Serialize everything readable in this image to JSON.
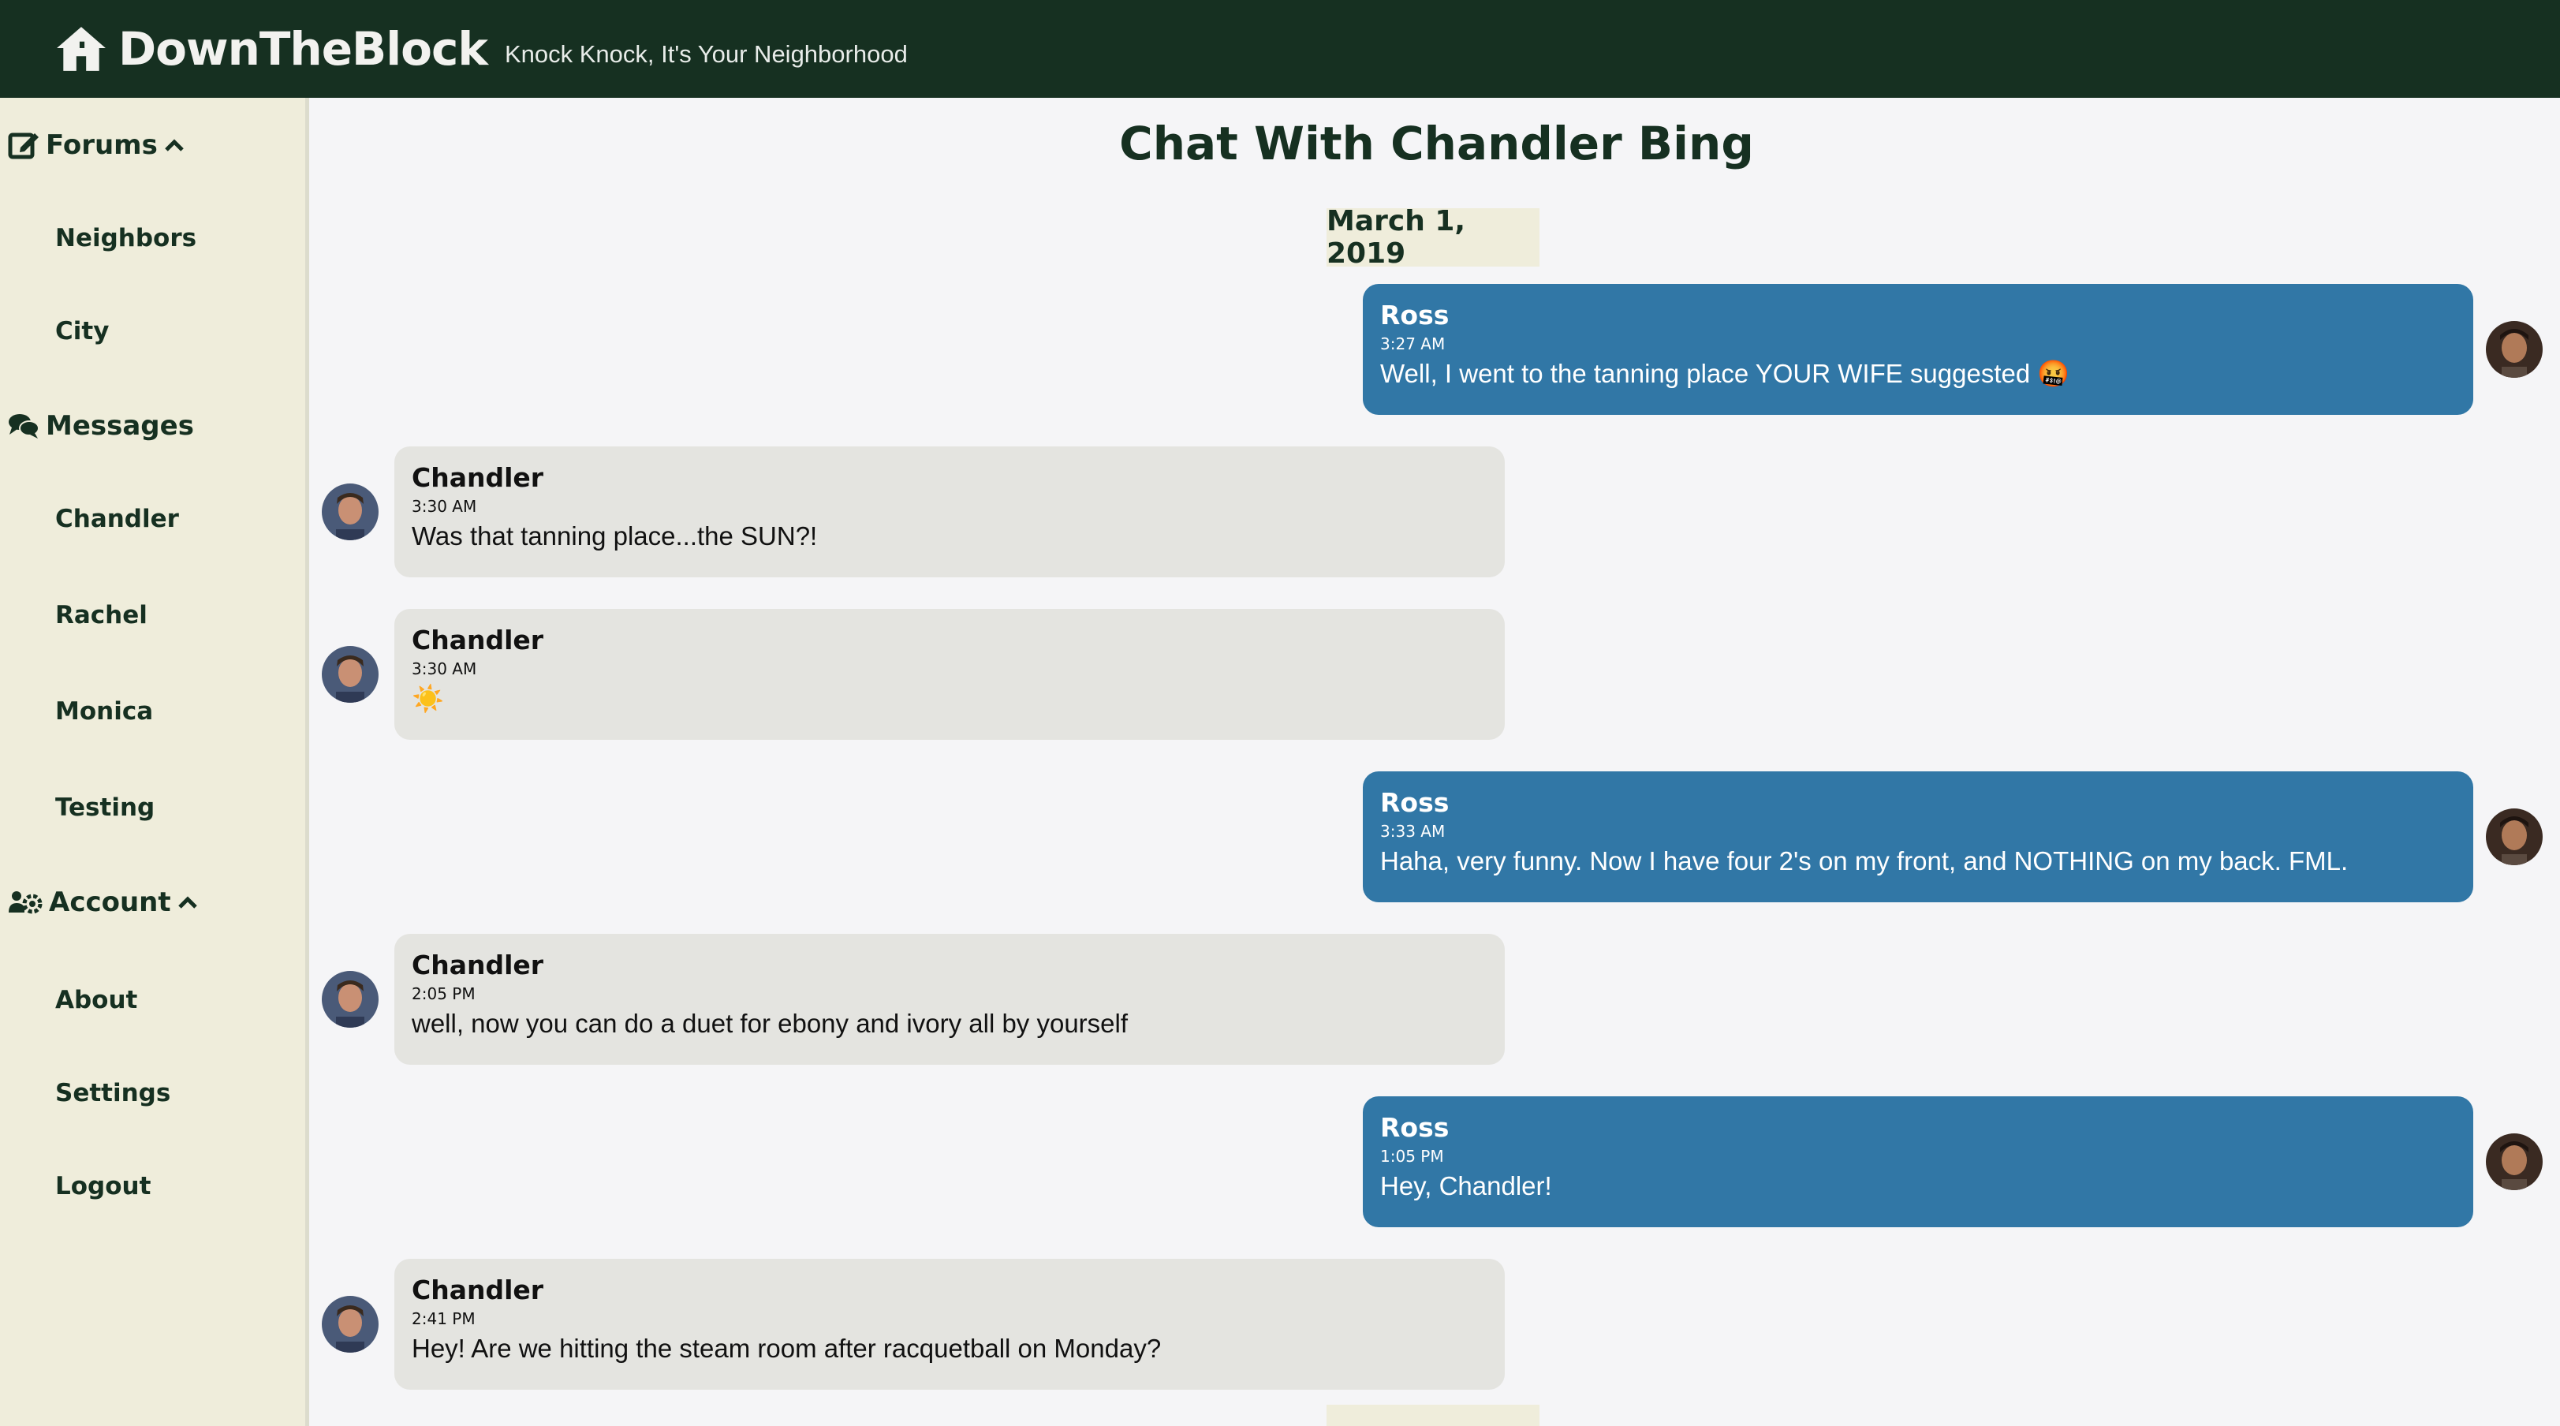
{
  "header": {
    "brand": "DownTheBlock",
    "tagline": "Knock Knock, It's Your Neighborhood",
    "logo_icon": "home-icon"
  },
  "sidebar": {
    "forums": {
      "label": "Forums",
      "icon": "edit-icon",
      "items": [
        "Neighbors",
        "City"
      ]
    },
    "messages": {
      "label": "Messages",
      "icon": "chat-icon",
      "items": [
        "Chandler",
        "Rachel",
        "Monica",
        "Testing"
      ]
    },
    "account": {
      "label": "Account",
      "icon": "users-cog-icon",
      "items": [
        "About",
        "Settings",
        "Logout"
      ]
    }
  },
  "chat": {
    "title": "Chat With Chandler Bing",
    "date": "March 1, 2019",
    "messages": [
      {
        "sender": "Ross",
        "time": "3:27 AM",
        "text": "Well, I went to the tanning place YOUR WIFE suggested 🤬"
      },
      {
        "sender": "Chandler",
        "time": "3:30 AM",
        "text": "Was that tanning place...the SUN?!"
      },
      {
        "sender": "Chandler",
        "time": "3:30 AM",
        "text": "☀️"
      },
      {
        "sender": "Ross",
        "time": "3:33 AM",
        "text": "Haha, very funny. Now I have four 2's on my front, and NOTHING on my back. FML."
      },
      {
        "sender": "Chandler",
        "time": "2:05 PM",
        "text": "well, now you can do a duet for ebony and ivory all by yourself"
      },
      {
        "sender": "Ross",
        "time": "1:05 PM",
        "text": "Hey, Chandler!"
      },
      {
        "sender": "Chandler",
        "time": "2:41 PM",
        "text": "Hey! Are we hitting the steam room after racquetball on Monday?"
      }
    ]
  },
  "colors": {
    "header_bg": "#163021",
    "sidebar_bg": "#efeddb",
    "ross_bubble": "#3177a6",
    "chandler_bubble": "#e4e4e0"
  }
}
